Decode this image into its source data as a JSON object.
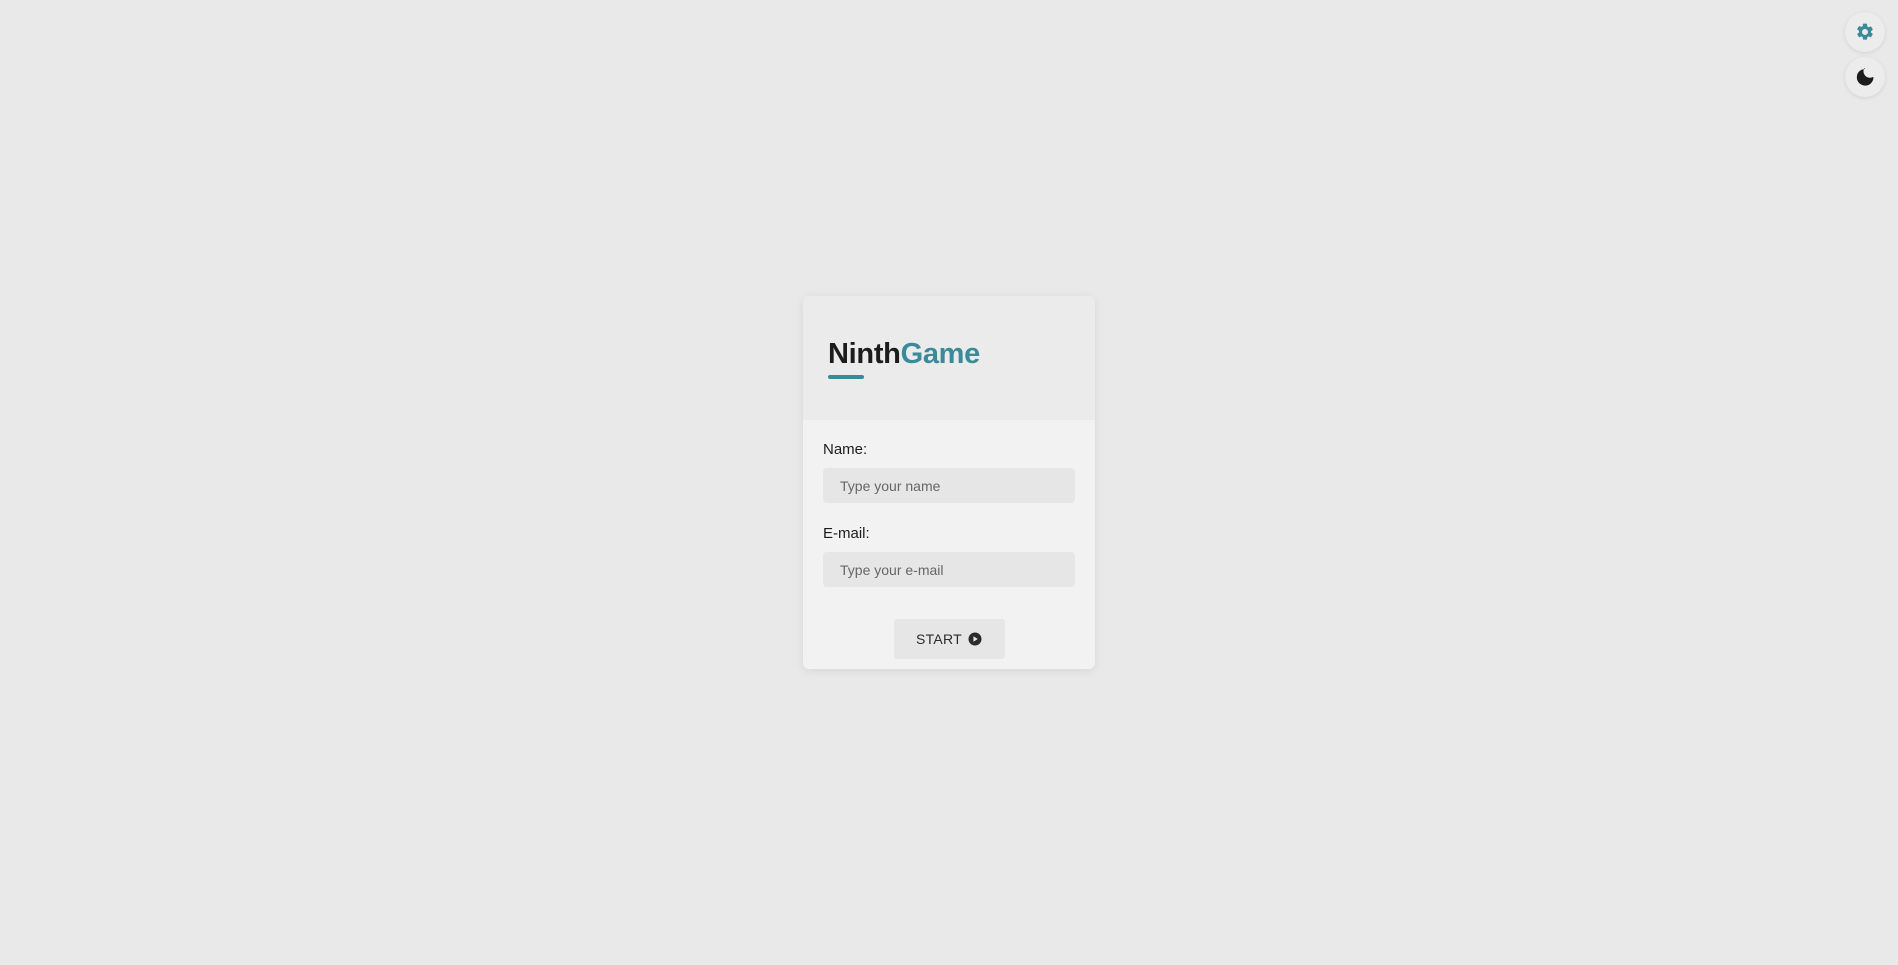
{
  "corner_controls": {
    "settings_icon": "gear-icon",
    "theme_icon": "moon-icon"
  },
  "brand": {
    "name_part1": "Ninth",
    "name_part2": "Game",
    "accent_color": "#3a8a99"
  },
  "form": {
    "name_label": "Name:",
    "name_placeholder": "Type your name",
    "name_value": "",
    "email_label": "E-mail:",
    "email_placeholder": "Type your e-mail",
    "email_value": "",
    "start_label": "START",
    "start_icon": "play-circle-icon"
  }
}
